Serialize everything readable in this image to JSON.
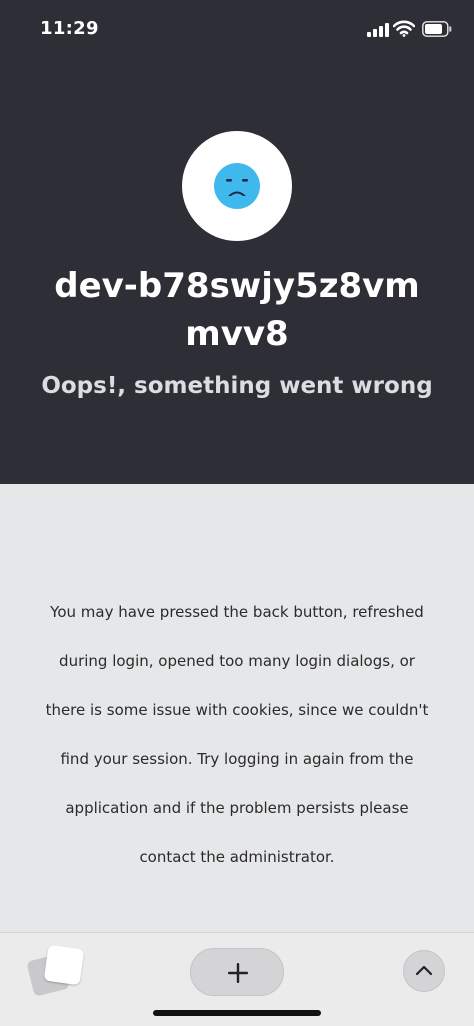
{
  "status_bar": {
    "time": "11:29",
    "icons": [
      "cellular-signal-icon",
      "wifi-icon",
      "battery-icon"
    ]
  },
  "header": {
    "avatar_icon": "sad-face-icon",
    "tenant_name": "dev-b78swjy5z8vmmvv8",
    "error_title": "Oops!, something went wrong"
  },
  "body": {
    "message": "You may have pressed the back button, refreshed during login, opened too many login dialogs, or there is some issue with cookies, since we couldn't find your session. Try logging in again from the application and if the problem persists please contact the administrator."
  },
  "toolbar": {
    "icons": [
      "tabs-icon",
      "plus-icon",
      "chevron-up-icon"
    ]
  },
  "colors": {
    "header_background": "#2d2e36",
    "body_background": "#e6e7e9",
    "face_color": "#3fb8ee",
    "face_features": "#1e2a4a"
  }
}
